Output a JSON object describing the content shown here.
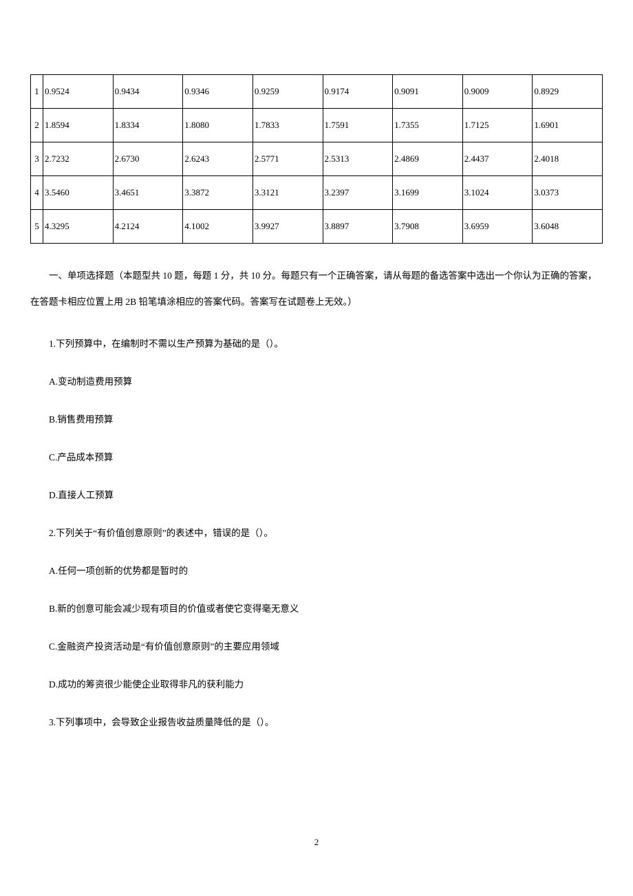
{
  "chart_data": {
    "type": "table",
    "columns": [
      "row",
      "c1",
      "c2",
      "c3",
      "c4",
      "c5",
      "c6",
      "c7",
      "c8"
    ],
    "rows": [
      {
        "row": "1",
        "c1": "0.9524",
        "c2": "0.9434",
        "c3": "0.9346",
        "c4": "0.9259",
        "c5": "0.9174",
        "c6": "0.9091",
        "c7": "0.9009",
        "c8": "0.8929"
      },
      {
        "row": "2",
        "c1": "1.8594",
        "c2": "1.8334",
        "c3": "1.8080",
        "c4": "1.7833",
        "c5": "1.7591",
        "c6": "1.7355",
        "c7": "1.7125",
        "c8": "1.6901"
      },
      {
        "row": "3",
        "c1": "2.7232",
        "c2": "2.6730",
        "c3": "2.6243",
        "c4": "2.5771",
        "c5": "2.5313",
        "c6": "2.4869",
        "c7": "2.4437",
        "c8": "2.4018"
      },
      {
        "row": "4",
        "c1": "3.5460",
        "c2": "3.4651",
        "c3": "3.3872",
        "c4": "3.3121",
        "c5": "3.2397",
        "c6": "3.1699",
        "c7": "3.1024",
        "c8": "3.0373"
      },
      {
        "row": "5",
        "c1": "4.3295",
        "c2": "4.2124",
        "c3": "4.1002",
        "c4": "3.9927",
        "c5": "3.8897",
        "c6": "3.7908",
        "c7": "3.6959",
        "c8": "3.6048"
      }
    ]
  },
  "section_intro": "一、单项选择题（本题型共 10 题，每题 1 分，共 10 分。每题只有一个正确答案，请从每题的备选答案中选出一个你认为正确的答案，在答题卡相应位置上用 2B 铅笔填涂相应的答案代码。答案写在试题卷上无效。）",
  "questions": [
    {
      "stem": "1.下列预算中，在编制时不需以生产预算为基础的是（）。",
      "options": [
        "A.变动制造费用预算",
        "B.销售费用预算",
        "C.产品成本预算",
        "D.直接人工预算"
      ]
    },
    {
      "stem": "2.下列关于“有价值创意原则”的表述中，错误的是（）。",
      "options": [
        "A.任何一项创新的优势都是暂时的",
        "B.新的创意可能会减少现有项目的价值或者使它变得毫无意义",
        "C.金融资产投资活动是“有价值创意原则”的主要应用领域",
        "D.成功的筹资很少能使企业取得非凡的获利能力"
      ]
    },
    {
      "stem": "3.下列事项中，会导致企业报告收益质量降低的是（）。",
      "options": []
    }
  ],
  "page_number": "2"
}
